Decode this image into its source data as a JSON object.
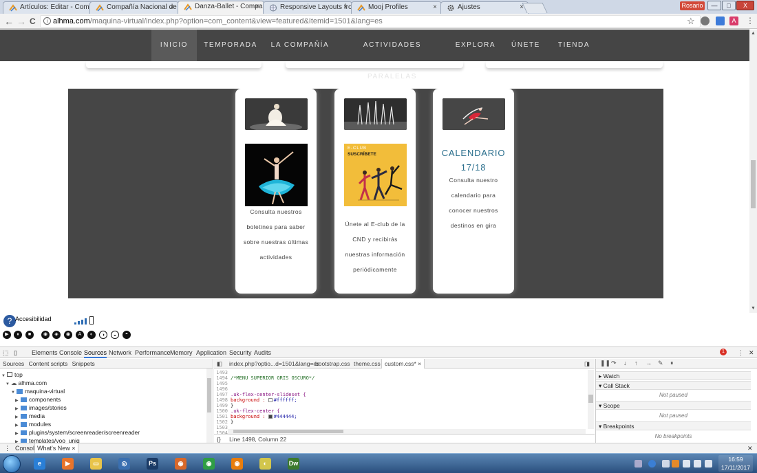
{
  "browser": {
    "tabs": [
      {
        "label": "Artículos: Editar - Compa",
        "icon": "joomla-icon",
        "active": false
      },
      {
        "label": "Compañía Nacional de D",
        "icon": "joomla-icon",
        "active": false
      },
      {
        "label": "Danza-Ballet - Compañía",
        "icon": "joomla-icon",
        "active": true
      },
      {
        "label": "Responsive Layouts from",
        "icon": "globe-icon",
        "active": false
      },
      {
        "label": "Mooj Profiles",
        "icon": "joomla-icon",
        "active": false
      },
      {
        "label": "Ajustes",
        "icon": "gear-icon",
        "active": false
      }
    ],
    "tab_close": "×",
    "user": "Rosario",
    "window_buttons": {
      "minimize": "—",
      "maximize": "□",
      "close": "X"
    },
    "url_host": "alhma.com",
    "url_path": "/maquina-virtual/index.php?option=com_content&view=featured&Itemid=1501&lang=es",
    "back": "←",
    "forward": "→",
    "reload": "C",
    "bookmark_star": "☆",
    "menu": "⋮"
  },
  "site": {
    "nav": [
      {
        "label": "INICIO",
        "active": true
      },
      {
        "label": "TEMPORADA",
        "active": false
      },
      {
        "label": "LA COMPAÑÍA",
        "active": false
      },
      {
        "label": "ACTIVIDADES PARALELAS",
        "active": false
      },
      {
        "label": "EXPLORA",
        "active": false
      },
      {
        "label": "ÚNETE",
        "active": false
      },
      {
        "label": "TIENDA",
        "active": false
      }
    ],
    "cards": [
      {
        "desc_lines": [
          "Consulta nuestros",
          "boletines para saber",
          "sobre nuestras últimas",
          "actividades"
        ]
      },
      {
        "banner_top": "E-CLUB",
        "banner_title": "SUSCRÍBETE",
        "desc_lines": [
          "Únete al E-club de la",
          "CND y recibirás",
          "nuestras información",
          "periódicamente"
        ]
      },
      {
        "title_lines": [
          "CALENDARIO",
          "17/18"
        ],
        "desc_lines": [
          "Consulta nuestro",
          "calendario para",
          "conocer nuestros",
          "destinos en gira"
        ]
      }
    ]
  },
  "accessibility": {
    "label": "Accesibilidad",
    "logo": "?",
    "controls": [
      "▶",
      "⏸",
      "■",
      "◉",
      "◈",
      "◉",
      "A",
      "◐",
      "◑",
      "◒",
      "◓"
    ]
  },
  "devtools": {
    "tabs": [
      "Elements",
      "Console",
      "Sources",
      "Network",
      "Performance",
      "Memory",
      "Application",
      "Security",
      "Audits"
    ],
    "active_tab": "Sources",
    "error_count": "1",
    "nav_subtabs": [
      "Sources",
      "Content scripts",
      "Snippets"
    ],
    "tree": [
      {
        "label": "top",
        "depth": 0,
        "kind": "frame"
      },
      {
        "label": "alhma.com",
        "depth": 1,
        "kind": "cloud"
      },
      {
        "label": "maquina-virtual",
        "depth": 2,
        "kind": "folder"
      },
      {
        "label": "components",
        "depth": 3,
        "kind": "folder"
      },
      {
        "label": "images/stories",
        "depth": 3,
        "kind": "folder"
      },
      {
        "label": "media",
        "depth": 3,
        "kind": "folder"
      },
      {
        "label": "modules",
        "depth": 3,
        "kind": "folder"
      },
      {
        "label": "plugins/system/screenreader/screenreader",
        "depth": 3,
        "kind": "folder"
      },
      {
        "label": "templates/yoo_uniq",
        "depth": 3,
        "kind": "folder"
      }
    ],
    "file_tabs": [
      "index.php?optio...d=1501&lang=es",
      "bootstrap.css",
      "theme.css",
      "custom.css* ×"
    ],
    "code": [
      {
        "n": "1493",
        "text": "",
        "cls": ""
      },
      {
        "n": "1494",
        "text": "/*MENU SUPERIOR GRIS OSCURO*/",
        "cls": "c-com"
      },
      {
        "n": "1495",
        "text": "",
        "cls": ""
      },
      {
        "n": "1496",
        "text": "",
        "cls": ""
      },
      {
        "n": "1497",
        "text": ".uk-flex-center-slideset {",
        "cls": "c-sel"
      },
      {
        "n": "1498",
        "prop": "background :",
        "swatch": "#ffffff",
        "val": "#ffffff;"
      },
      {
        "n": "1499",
        "text": "}",
        "cls": ""
      },
      {
        "n": "1500",
        "text": ".uk-flex-center {",
        "cls": "c-sel"
      },
      {
        "n": "1501",
        "prop": "background :",
        "swatch": "#444444",
        "val": "#444444;"
      },
      {
        "n": "1502",
        "text": "}",
        "cls": ""
      },
      {
        "n": "1503",
        "text": "",
        "cls": ""
      },
      {
        "n": "1504",
        "text": "",
        "cls": ""
      }
    ],
    "status": "Line 1498, Column 22",
    "status_icon": "{}",
    "panes": [
      {
        "title": "▸ Watch",
        "body": ""
      },
      {
        "title": "▾ Call Stack",
        "body": "Not paused"
      },
      {
        "title": "▾ Scope",
        "body": "Not paused"
      },
      {
        "title": "▾ Breakpoints",
        "body": "No breakpoints"
      }
    ],
    "drawer_tabs": [
      "Console",
      "What's New ×"
    ]
  },
  "taskbar": {
    "apps": [
      {
        "name": "ie-icon",
        "glyph": "e",
        "color": "#2a7fd6"
      },
      {
        "name": "media-player-icon",
        "glyph": "▶",
        "color": "#e8742b"
      },
      {
        "name": "explorer-icon",
        "glyph": "▭",
        "color": "#e8c44a"
      },
      {
        "name": "app-icon",
        "glyph": "◎",
        "color": "#3a6fb0"
      },
      {
        "name": "photoshop-icon",
        "glyph": "Ps",
        "color": "#1b3b66"
      },
      {
        "name": "firefox-icon",
        "glyph": "◉",
        "color": "#d8682a"
      },
      {
        "name": "chrome-icon",
        "glyph": "◉",
        "color": "#2f9e44"
      },
      {
        "name": "blender-icon",
        "glyph": "◉",
        "color": "#e87d0d"
      },
      {
        "name": "folder-icon",
        "glyph": "◐",
        "color": "#d2c64c"
      },
      {
        "name": "dreamweaver-icon",
        "glyph": "Dw",
        "color": "#3c7a2d"
      }
    ],
    "time": "16:59",
    "date": "17/11/2017"
  }
}
